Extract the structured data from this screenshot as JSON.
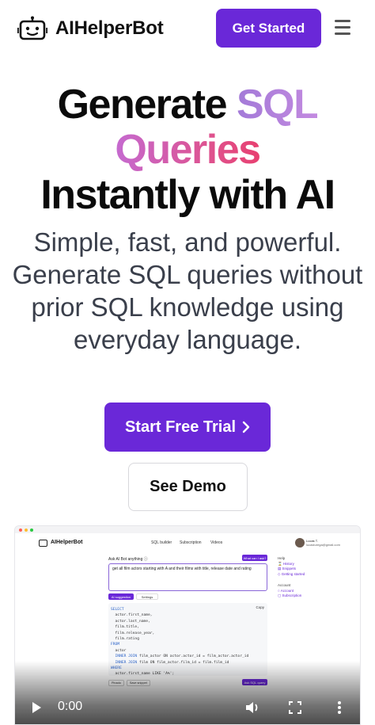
{
  "header": {
    "brand": "AIHelperBot",
    "cta_label": "Get Started",
    "logo_icon": "robot-icon",
    "menu_icon": "hamburger-menu-icon"
  },
  "hero": {
    "title_part1": "Generate ",
    "title_sql": "SQL",
    "title_queries": "Queries",
    "title_part3": "Instantly with AI",
    "subtitle": "Simple, fast, and powerful. Generate SQL queries without prior SQL knowledge using everyday language.",
    "primary_button": "Start Free Trial",
    "primary_button_icon": "chevron-right-icon",
    "secondary_button": "See Demo"
  },
  "colors": {
    "accent": "#6a28d8",
    "sql_gradient": [
      "#a37ad8",
      "#c38ae0"
    ],
    "queries_gradient": [
      "#c56ad0",
      "#e84070"
    ]
  },
  "video_preview": {
    "app": {
      "brand": "AIHelperBot",
      "nav": [
        "SQL builder",
        "Subscription",
        "Videos"
      ],
      "user_name": "Lucas T.",
      "user_email": "lucasturega@gmail.com"
    },
    "ask_label": "Ask AI Bot anything ⓘ",
    "what_can_label": "What can I ask?",
    "prompt": "get all film actors starting with A and their films with title, release date and rating",
    "tabs": [
      "AI suggestion",
      "Settings"
    ],
    "copy_label": "Copy",
    "sql_lines": [
      {
        "kw": "SELECT",
        "rest": ""
      },
      {
        "kw": "",
        "rest": "  actor.first_name,"
      },
      {
        "kw": "",
        "rest": "  actor.last_name,"
      },
      {
        "kw": "",
        "rest": "  film.title,"
      },
      {
        "kw": "",
        "rest": "  film.release_year,"
      },
      {
        "kw": "",
        "rest": "  film.rating"
      },
      {
        "kw": "FROM",
        "rest": ""
      },
      {
        "kw": "",
        "rest": "  actor"
      },
      {
        "kw": "  INNER JOIN",
        "rest": " film_actor ON actor.actor_id = film_actor.actor_id"
      },
      {
        "kw": "  INNER JOIN",
        "rest": " film ON film_actor.film_id = film.film_id"
      },
      {
        "kw": "WHERE",
        "rest": ""
      },
      {
        "kw": "",
        "rest": "  actor.first_name LIKE 'A%';"
      }
    ],
    "bottom_chips": [
      "Pinado",
      "Save snippet"
    ],
    "ask_sql_label": "Ask SQL query",
    "sidebar": {
      "help_heading": "Help",
      "help_links": [
        "History",
        "Snippets",
        "Getting started"
      ],
      "account_heading": "Account",
      "account_links": [
        "Account",
        "Subscription"
      ]
    },
    "player": {
      "time": "0:00",
      "play_icon": "play-icon",
      "volume_icon": "volume-icon",
      "fullscreen_icon": "fullscreen-icon",
      "more_icon": "more-vertical-icon"
    }
  }
}
